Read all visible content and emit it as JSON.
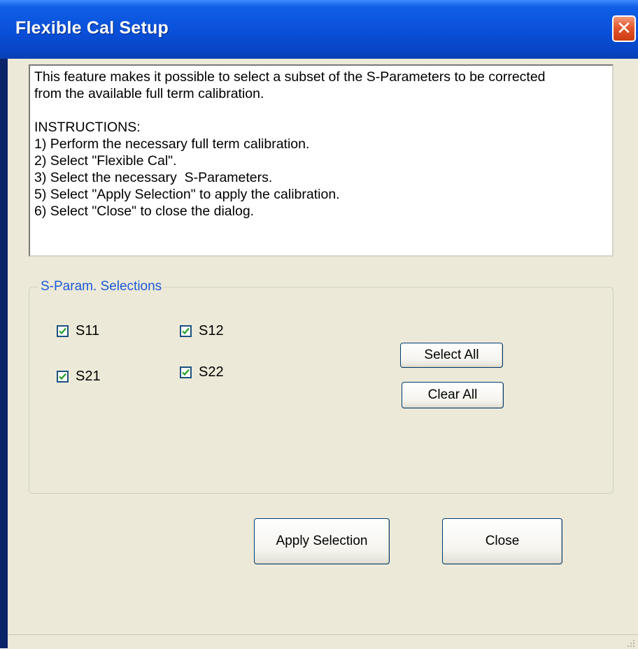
{
  "window": {
    "title": "Flexible Cal Setup",
    "close_glyph": "✕"
  },
  "info": {
    "text": "This feature makes it possible to select a subset of the S-Parameters to be corrected\nfrom the available full term calibration.\n\nINSTRUCTIONS:\n1) Perform the necessary full term calibration.\n2) Select \"Flexible Cal\".\n3) Select the necessary  S-Parameters.\n5) Select \"Apply Selection\" to apply the calibration.\n6) Select \"Close\" to close the dialog."
  },
  "selections": {
    "group_label": "S-Param. Selections",
    "items": [
      {
        "label": "S11",
        "checked": true
      },
      {
        "label": "S12",
        "checked": true
      },
      {
        "label": "S21",
        "checked": true
      },
      {
        "label": "S22",
        "checked": true
      }
    ],
    "select_all_label": "Select All",
    "clear_all_label": "Clear All"
  },
  "buttons": {
    "apply_label": "Apply Selection",
    "close_label": "Close"
  },
  "colors": {
    "title_bar": "#0a4fd8",
    "group_label": "#1c5ad6",
    "checkmark": "#21a121",
    "dialog_bg": "#ece9d8"
  }
}
